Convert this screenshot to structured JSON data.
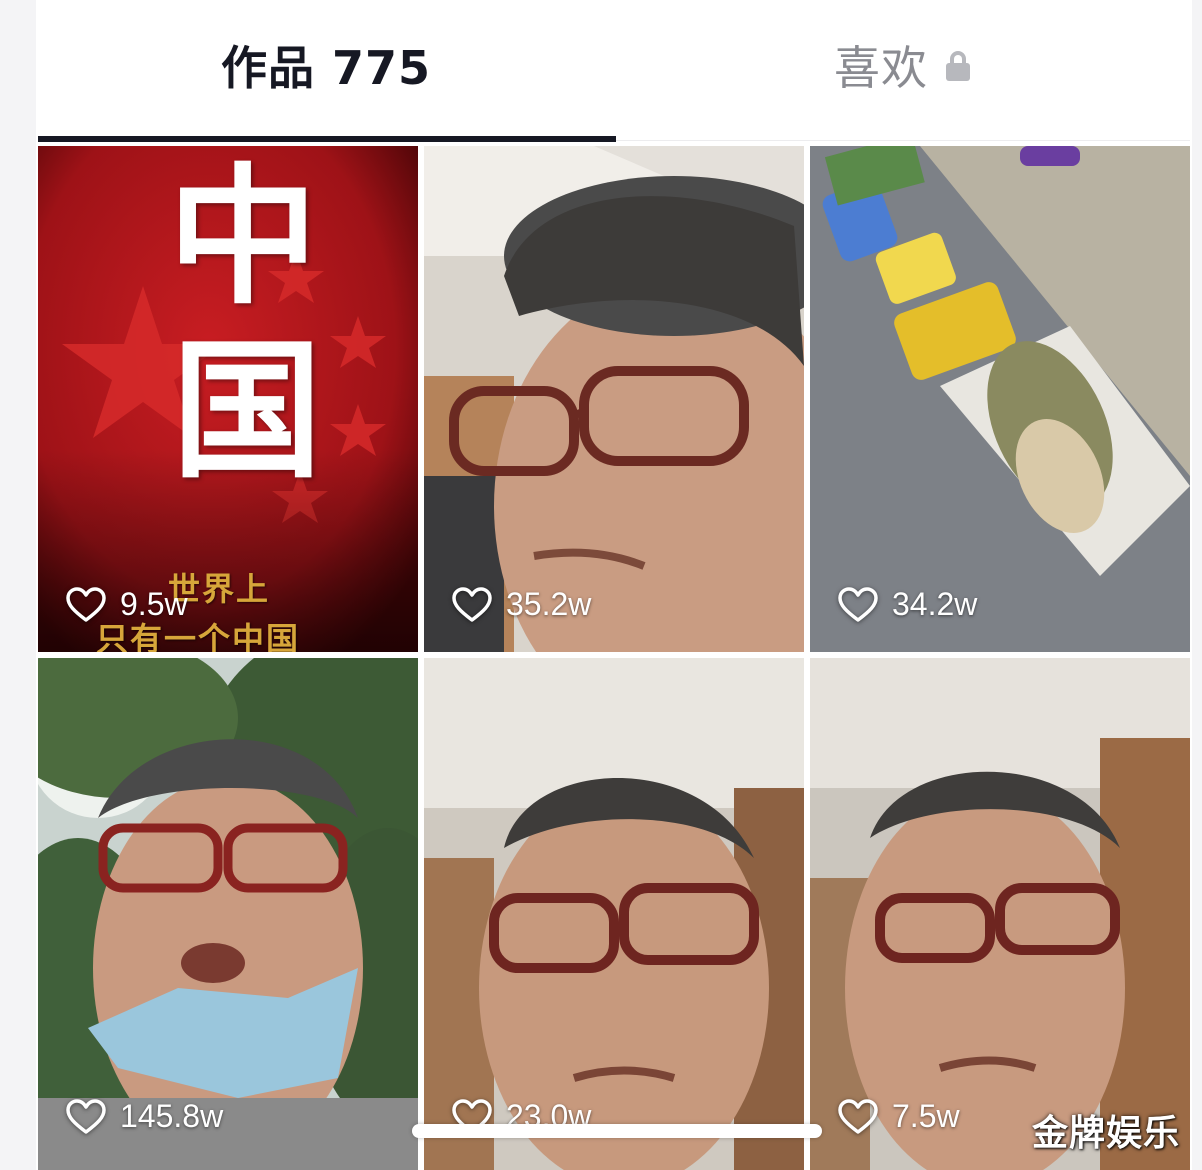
{
  "tabs": {
    "works_label": "作品 775",
    "likes_label": "喜欢",
    "active": "works"
  },
  "videos": [
    {
      "likes": "9.5w",
      "type": "poster",
      "poster_title_top": "中",
      "poster_title_bottom": "国",
      "poster_subtitle_line1": "世界上",
      "poster_subtitle_line2": "只有一个中国"
    },
    {
      "likes": "35.2w",
      "type": "selfie"
    },
    {
      "likes": "34.2w",
      "type": "cat"
    },
    {
      "likes": "145.8w",
      "type": "selfie-outdoor"
    },
    {
      "likes": "23.0w",
      "type": "selfie"
    },
    {
      "likes": "7.5w",
      "type": "selfie"
    }
  ],
  "watermark": "金牌娱乐",
  "colors": {
    "active_tab_text": "#161823",
    "inactive_tab_text": "#8a8b91",
    "indicator": "#161823",
    "poster_red": "#b3161c",
    "poster_gold": "#d7a63a"
  },
  "icons": {
    "lock": "lock-icon",
    "heart": "heart-outline-icon"
  }
}
